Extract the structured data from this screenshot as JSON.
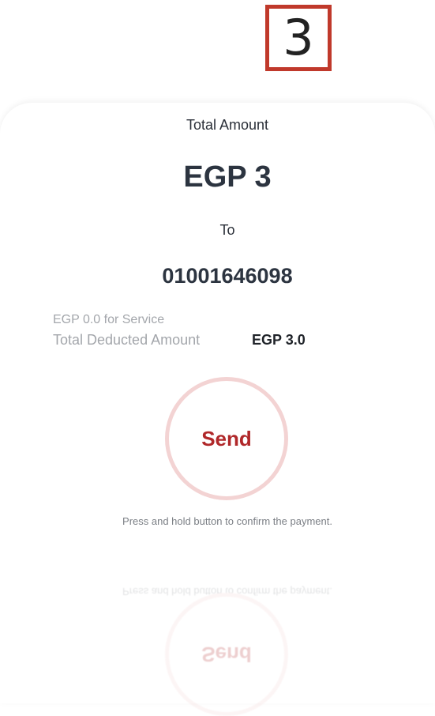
{
  "step": {
    "number": "3",
    "border_color": "#c0392b"
  },
  "payment": {
    "total_label": "Total Amount",
    "amount": "EGP 3",
    "to_label": "To",
    "recipient": "01001646098",
    "service_fee": "EGP 0.0 for Service",
    "deducted_label": "Total Deducted Amount",
    "deducted_value": "EGP 3.0"
  },
  "send": {
    "label": "Send",
    "hint": "Press and hold button to confirm the payment.",
    "accent_color": "#b0282a"
  }
}
